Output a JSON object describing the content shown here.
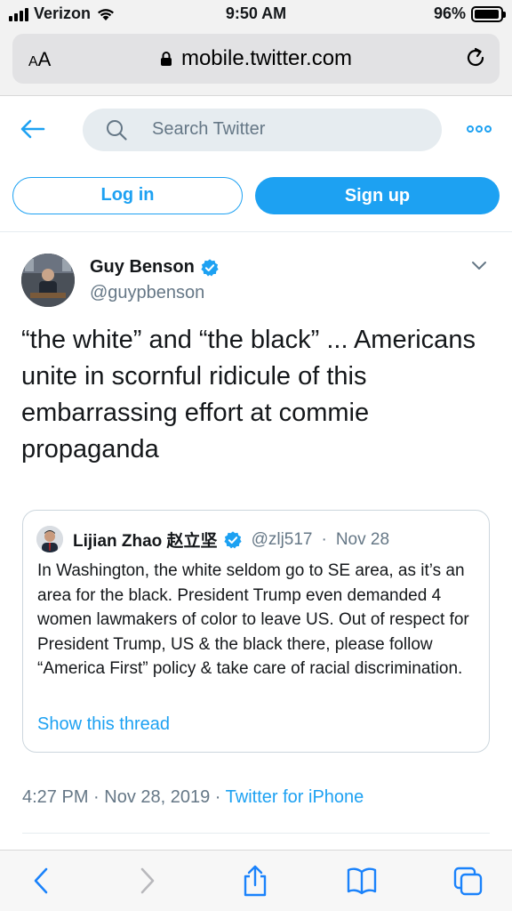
{
  "status_bar": {
    "carrier": "Verizon",
    "time": "9:50 AM",
    "battery": "96%",
    "battery_level": 0.96
  },
  "browser": {
    "aa_label": "AA",
    "url": "mobile.twitter.com",
    "icons": [
      "lock-icon",
      "reload-icon"
    ]
  },
  "twitter_header": {
    "search_placeholder": "Search Twitter",
    "login_label": "Log in",
    "signup_label": "Sign up",
    "accent_color": "#1da1f2"
  },
  "tweet": {
    "author_name": "Guy Benson",
    "author_handle": "@guypbenson",
    "verified": true,
    "text": "“the white” and “the black” ... Americans unite in scornful ridicule of this embarrassing effort at commie propaganda",
    "quoted": {
      "author_name": "Lijian Zhao 赵立坚",
      "author_handle": "@zlj517",
      "separator": "·",
      "date": "Nov 28",
      "verified": true,
      "text": "In Washington, the white seldom go to SE area, as it’s an area for the black. President Trump even demanded 4 women lawmakers of color to leave US. Out of respect for President Trump, US & the black there, please follow “America First” policy & take care of racial discrimination.",
      "show_thread": "Show this thread"
    },
    "timestamp": "4:27 PM · Nov 28, 2019",
    "meta_separator": "·",
    "source": "Twitter for iPhone"
  },
  "toolbar": {
    "icons": [
      "back-icon",
      "forward-icon",
      "share-icon",
      "bookmarks-icon",
      "tabs-icon"
    ]
  }
}
